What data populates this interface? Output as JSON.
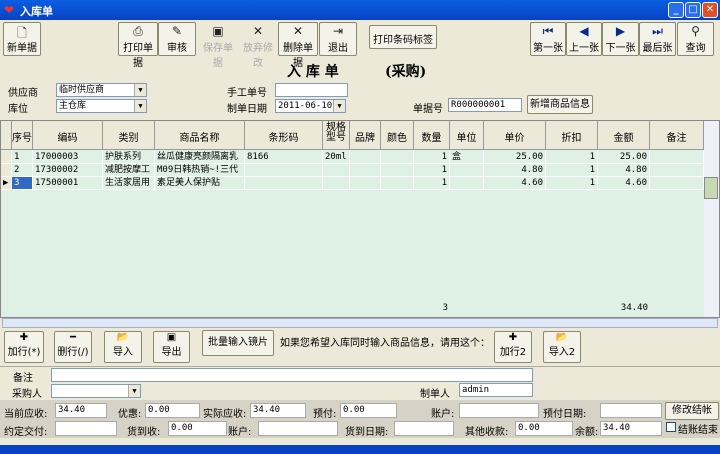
{
  "window": {
    "title": "入库单"
  },
  "toolbar": {
    "new": "新单据",
    "print": "打印单据",
    "audit": "审核",
    "save": "保存单据",
    "discard": "放弃修改",
    "delete": "删除单据",
    "exit": "退出",
    "print_barcode": "打印条码标签",
    "first": "第一张",
    "prev": "上一张",
    "next": "下一张",
    "last": "最后张",
    "query": "查询"
  },
  "header": {
    "title": "入 库 单",
    "subtitle": "(采购)"
  },
  "form": {
    "supplier_label": "供应商",
    "supplier": "临时供应商",
    "location_label": "库位",
    "location": "主仓库",
    "manual_no_label": "手工单号",
    "manual_no": "",
    "date_label": "制单日期",
    "date": "2011-06-10",
    "doc_no_label": "单据号",
    "doc_no": "R000000001",
    "add_product": "新增商品信息"
  },
  "grid": {
    "columns": [
      "序号",
      "编码",
      "类别",
      "商品名称",
      "条形码",
      "规格型号",
      "品牌",
      "颜色",
      "数量",
      "单位",
      "单价",
      "折扣",
      "金额",
      "备注"
    ],
    "rows": [
      [
        "1",
        "17000003",
        "护肤系列",
        "丝瓜健康亮颜隔离乳",
        "8166",
        "20ml",
        "",
        "",
        "1",
        "盒",
        "25.00",
        "1",
        "25.00",
        ""
      ],
      [
        "2",
        "17300002",
        "减肥按摩工",
        "M09日韩热销~!三代",
        "",
        "",
        "",
        "",
        "1",
        "",
        "4.80",
        "1",
        "4.80",
        ""
      ],
      [
        "3",
        "17500001",
        "生活家居用",
        "素足美人保护贴",
        "",
        "",
        "",
        "",
        "1",
        "",
        "4.60",
        "1",
        "4.60",
        ""
      ]
    ],
    "total_qty": "3",
    "total_amount": "34.40"
  },
  "actions": {
    "add_row": "加行(*)",
    "del_row": "删行(/)",
    "import": "导入",
    "export": "导出",
    "batch": "批量输入镜片",
    "hint": "如果您希望入库同时输入商品信息，请用这个：",
    "add_row2": "加行2",
    "import2": "导入2"
  },
  "footer": {
    "remark_label": "备注",
    "remark": "",
    "buyer_label": "采购人",
    "buyer": "",
    "maker_label": "制单人",
    "maker": "admin",
    "cur_due_label": "当前应收:",
    "cur_due": "34.40",
    "discount_label": "优惠:",
    "discount": "0.00",
    "actual_due_label": "实际应收:",
    "actual_due": "34.40",
    "prepaid_label": "预付:",
    "prepaid": "0.00",
    "account_label": "账户:",
    "account": "",
    "prepaid_date_label": "预付日期:",
    "prepaid_date": "",
    "modify_btn": "修改结帐",
    "agreed_label": "约定交付:",
    "agreed": "",
    "cod_label": "货到收:",
    "cod": "0.00",
    "account2_label": "账户:",
    "account2": "",
    "arrival_label": "货到日期:",
    "arrival": "",
    "other_label": "其他收款:",
    "other": "0.00",
    "balance_label": "余额:",
    "balance": "34.40",
    "settled_label": "结账结束"
  }
}
